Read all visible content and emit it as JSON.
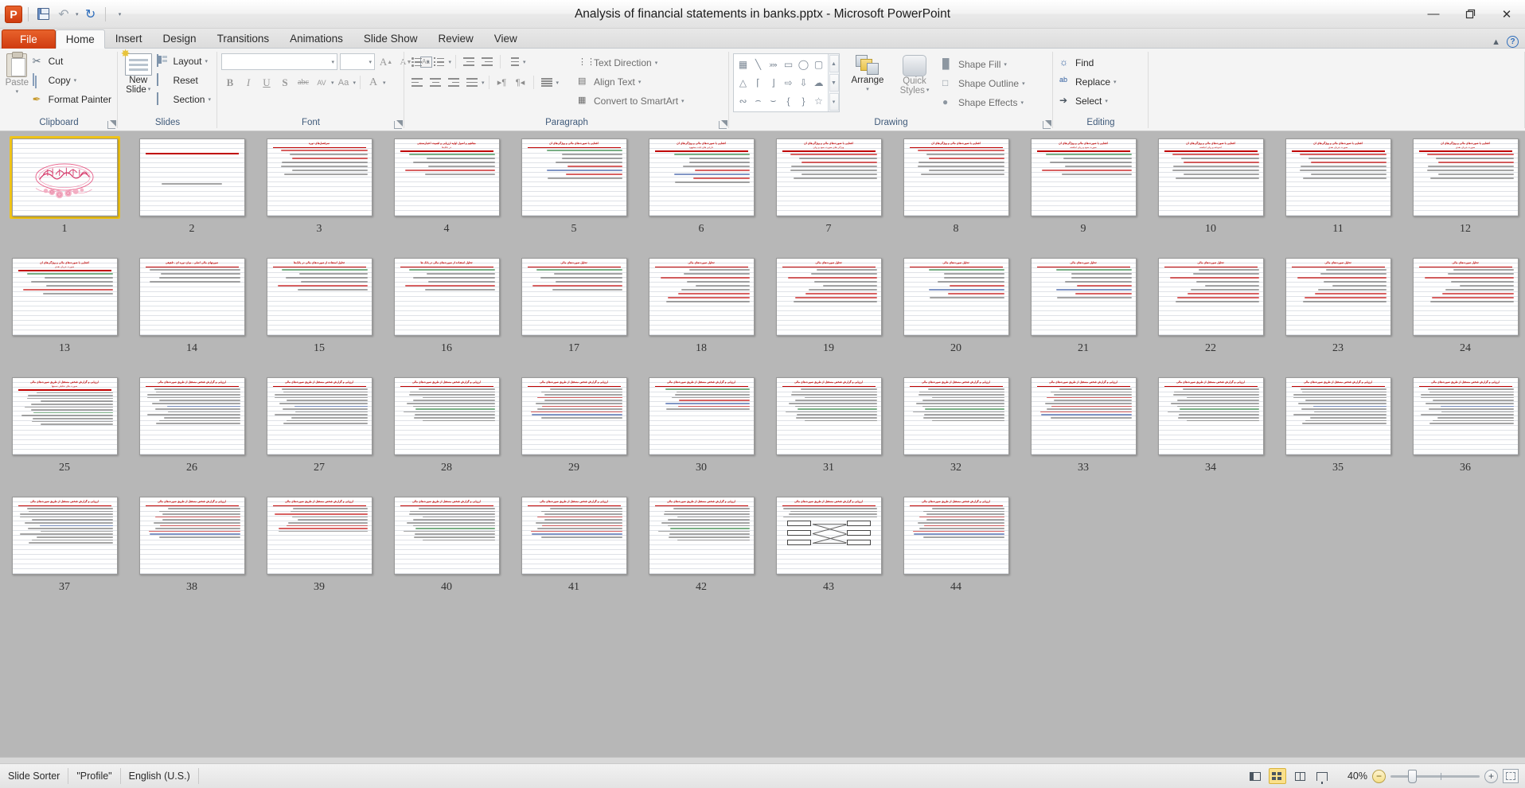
{
  "window": {
    "title": "Analysis of financial statements in banks.pptx  -  Microsoft PowerPoint",
    "app_icon": "powerpoint-icon",
    "minimize": "—",
    "restore": "❐",
    "close": "✕"
  },
  "quick_access": {
    "save": "save-icon",
    "undo": "↺",
    "undo_caret": "▾",
    "redo": "↻",
    "customize": "▾"
  },
  "tabs": [
    {
      "label": "File",
      "active": false,
      "file": true
    },
    {
      "label": "Home",
      "active": true
    },
    {
      "label": "Insert",
      "active": false
    },
    {
      "label": "Design",
      "active": false
    },
    {
      "label": "Transitions",
      "active": false
    },
    {
      "label": "Animations",
      "active": false
    },
    {
      "label": "Slide Show",
      "active": false
    },
    {
      "label": "Review",
      "active": false
    },
    {
      "label": "View",
      "active": false
    }
  ],
  "tab_right": {
    "minimize_ribbon": "▲",
    "help": "?"
  },
  "ribbon": {
    "groups": [
      {
        "label": "Clipboard",
        "launcher": true
      },
      {
        "label": "Slides",
        "launcher": false
      },
      {
        "label": "Font",
        "launcher": true
      },
      {
        "label": "Paragraph",
        "launcher": true
      },
      {
        "label": "Drawing",
        "launcher": true
      },
      {
        "label": "Editing",
        "launcher": false
      }
    ],
    "clipboard": {
      "paste": "Paste",
      "paste_caret": "▾",
      "cut": "Cut",
      "copy": "Copy",
      "copy_caret": "▾",
      "format_painter": "Format Painter"
    },
    "slides": {
      "new_slide_line1": "New",
      "new_slide_line2": "Slide",
      "new_slide_caret": "▾",
      "layout": "Layout",
      "layout_caret": "▾",
      "reset": "Reset",
      "section": "Section",
      "section_caret": "▾"
    },
    "font": {
      "font_name": "",
      "font_size": "",
      "grow": "A",
      "shrink": "A",
      "clear_formatting": "Aa",
      "bold": "B",
      "italic": "I",
      "underline": "U",
      "shadow": "S",
      "strikethrough": "abc",
      "spacing": "AV",
      "change_case": "Aa",
      "font_color": "A"
    },
    "paragraph": {
      "bullets": "bullet-list-icon",
      "numbering": "numbered-list-icon",
      "decrease_indent": "decrease-indent-icon",
      "increase_indent": "increase-indent-icon",
      "line_spacing": "line-spacing-icon",
      "align_left": "align-left-icon",
      "align_center": "align-center-icon",
      "align_right": "align-right-icon",
      "justify": "justify-icon",
      "ltr": "▸¶",
      "rtl": "¶◂",
      "columns": "columns-icon",
      "text_direction": "Text Direction",
      "align_text": "Align Text",
      "convert_to_smartart": "Convert to SmartArt"
    },
    "drawing": {
      "shapes": [
        "text-box",
        "line",
        "arrow",
        "rectangle",
        "oval",
        "rounded-rectangle",
        "triangle",
        "elbow-connector",
        "elbow-arrow-connector",
        "right-arrow",
        "down-arrow",
        "cloud",
        "scribble",
        "curve",
        "arc",
        "left-brace",
        "right-brace",
        "star"
      ],
      "arrange": "Arrange",
      "arrange_caret": "▾",
      "quick_styles_line1": "Quick",
      "quick_styles_line2": "Styles",
      "quick_styles_caret": "▾",
      "shape_fill": "Shape Fill",
      "shape_outline": "Shape Outline",
      "shape_effects": "Shape Effects"
    },
    "editing": {
      "find": "Find",
      "replace": "Replace",
      "select": "Select"
    }
  },
  "status": {
    "view_mode": "Slide Sorter",
    "theme": "\"Profile\"",
    "language": "English (U.S.)",
    "zoom_level": "40%",
    "zoom_out": "−",
    "zoom_in": "+",
    "views": [
      {
        "name": "normal-view",
        "label": "Normal",
        "active": false
      },
      {
        "name": "slide-sorter-view",
        "label": "Slide Sorter",
        "active": true
      },
      {
        "name": "reading-view",
        "label": "Reading View",
        "active": false
      },
      {
        "name": "slide-show-view",
        "label": "Slide Show",
        "active": false
      }
    ],
    "fit_to_window": "fit-slide-to-window-icon"
  },
  "sorter": {
    "selected_slide": 1,
    "total_slides": 44,
    "slides": [
      {
        "n": 1,
        "kind": "bismillah",
        "title": "",
        "sub": "",
        "lines": 0
      },
      {
        "n": 2,
        "kind": "title-only",
        "title": "",
        "sub": "",
        "lines": 1
      },
      {
        "n": 3,
        "kind": "bulleted",
        "title": "سرفصل‌های دوره",
        "sub": "",
        "lines": 7
      },
      {
        "n": 4,
        "kind": "bulleted",
        "title": "مفاهیم و اصول اولیه ارزیابی و اهمیت اعتبارسنجی",
        "sub": "در بانک‌ها",
        "lines": 6
      },
      {
        "n": 5,
        "kind": "bulleted",
        "title": "آشنایی با صورت‌های مالی و ویژگی‌های آن",
        "sub": "",
        "lines": 8
      },
      {
        "n": 6,
        "kind": "bulleted",
        "title": "آشنایی با صورت‌های مالی و ویژگی‌های آن",
        "sub": "دارایی های ثابت مشهود",
        "lines": 8
      },
      {
        "n": 7,
        "kind": "bulleted",
        "title": "آشنایی با صورت‌های مالی و ویژگی‌های آن",
        "sub": "ویژگی های صورت سود و زیان",
        "lines": 7
      },
      {
        "n": 8,
        "kind": "bulleted",
        "title": "آشنایی با صورت‌های مالی و ویژگی‌های آن",
        "sub": "",
        "lines": 7
      },
      {
        "n": 9,
        "kind": "bulleted",
        "title": "آشنایی با صورت‌های مالی و ویژگی‌های آن",
        "sub": "صورت سود و زیان انباشته",
        "lines": 6
      },
      {
        "n": 10,
        "kind": "bulleted",
        "title": "آشنایی با صورت‌های مالی و ویژگی‌های آن",
        "sub": "اندوخته و زیان انباشته",
        "lines": 7
      },
      {
        "n": 11,
        "kind": "bulleted",
        "title": "آشنایی با صورت‌های مالی و ویژگی‌های آن",
        "sub": "صورت جریان نقدی",
        "lines": 7
      },
      {
        "n": 12,
        "kind": "bulleted",
        "title": "آشنایی با صورت‌های مالی و ویژگی‌های آن",
        "sub": "صورت جریان نقدی",
        "lines": 7
      },
      {
        "n": 13,
        "kind": "bulleted",
        "title": "آشنایی با صورت‌های مالی و ویژگی‌های آن",
        "sub": "صورت جریان نقدی",
        "lines": 6
      },
      {
        "n": 14,
        "kind": "bulleted",
        "title": "صورتهای مالی اصلی ، میان دوره ای ، تلفیقی",
        "sub": "",
        "lines": 4
      },
      {
        "n": 15,
        "kind": "bulleted",
        "title": "تحلیل استفاده از صورت‌های مالی در بانک‌ها",
        "sub": "",
        "lines": 6
      },
      {
        "n": 16,
        "kind": "bulleted",
        "title": "تحلیل استفاده از صورت‌های مالی در بانک ها",
        "sub": "",
        "lines": 6
      },
      {
        "n": 17,
        "kind": "bulleted",
        "title": "تحلیل صورت‌های مالی",
        "sub": "",
        "lines": 6
      },
      {
        "n": 18,
        "kind": "bulleted",
        "title": "تحلیل صورت‌های مالی",
        "sub": "",
        "lines": 9
      },
      {
        "n": 19,
        "kind": "bulleted",
        "title": "تحلیل صورت‌های مالی",
        "sub": "",
        "lines": 9
      },
      {
        "n": 20,
        "kind": "bulleted",
        "title": "تحلیل صورت‌های مالی",
        "sub": "",
        "lines": 8
      },
      {
        "n": 21,
        "kind": "bulleted",
        "title": "تحلیل صورت‌های مالی",
        "sub": "",
        "lines": 8
      },
      {
        "n": 22,
        "kind": "bulleted",
        "title": "تحلیل صورت‌های مالی",
        "sub": "",
        "lines": 9
      },
      {
        "n": 23,
        "kind": "bulleted",
        "title": "تحلیل صورت‌های مالی",
        "sub": "",
        "lines": 9
      },
      {
        "n": 24,
        "kind": "bulleted",
        "title": "تحلیل صورت‌های مالی",
        "sub": "",
        "lines": 9
      },
      {
        "n": 25,
        "kind": "dense",
        "title": "ارزیابی و گزارش شخص مستقل از طریق صورت‌های مالی",
        "sub": "صورت های تحلیلی نسبتها",
        "lines": 12
      },
      {
        "n": 26,
        "kind": "dense",
        "title": "ارزیابی و گزارش شخص مستقل از طریق صورت‌های مالی",
        "sub": "",
        "lines": 13
      },
      {
        "n": 27,
        "kind": "dense",
        "title": "ارزیابی و گزارش شخص مستقل از طریق صورت‌های مالی",
        "sub": "",
        "lines": 13
      },
      {
        "n": 28,
        "kind": "dense",
        "title": "ارزیابی و گزارش شخص مستقل از طریق صورت‌های مالی",
        "sub": "",
        "lines": 12
      },
      {
        "n": 29,
        "kind": "dense",
        "title": "ارزیابی و گزارش شخص مستقل از طریق صورت‌های مالی",
        "sub": "",
        "lines": 11
      },
      {
        "n": 30,
        "kind": "dense",
        "title": "ارزیابی و گزارش شخص مستقل از طریق صورت‌های مالی",
        "sub": "",
        "lines": 8
      },
      {
        "n": 31,
        "kind": "dense",
        "title": "ارزیابی و گزارش شخص مستقل از طریق صورت‌های مالی",
        "sub": "",
        "lines": 12
      },
      {
        "n": 32,
        "kind": "dense",
        "title": "ارزیابی و گزارش شخص مستقل از طریق صورت‌های مالی",
        "sub": "",
        "lines": 12
      },
      {
        "n": 33,
        "kind": "dense",
        "title": "ارزیابی و گزارش شخص مستقل از طریق صورت‌های مالی",
        "sub": "",
        "lines": 11
      },
      {
        "n": 34,
        "kind": "dense",
        "title": "ارزیابی و گزارش شخص مستقل از طریق صورت‌های مالی",
        "sub": "",
        "lines": 12
      },
      {
        "n": 35,
        "kind": "dense",
        "title": "ارزیابی و گزارش شخص مستقل از طریق صورت‌های مالی",
        "sub": "",
        "lines": 13
      },
      {
        "n": 36,
        "kind": "dense",
        "title": "ارزیابی و گزارش شخص مستقل از طریق صورت‌های مالی",
        "sub": "",
        "lines": 13
      },
      {
        "n": 37,
        "kind": "dense",
        "title": "ارزیابی و گزارش شخص مستقل از طریق صورت‌های مالی",
        "sub": "",
        "lines": 13
      },
      {
        "n": 38,
        "kind": "dense",
        "title": "ارزیابی و گزارش شخص مستقل از طریق صورت‌های مالی",
        "sub": "",
        "lines": 11
      },
      {
        "n": 39,
        "kind": "dense",
        "title": "ارزیابی و گزارش شخص مستقل از طریق صورت‌های مالی",
        "sub": "",
        "lines": 9
      },
      {
        "n": 40,
        "kind": "dense",
        "title": "ارزیابی و گزارش شخص مستقل از طریق صورت‌های مالی",
        "sub": "",
        "lines": 12
      },
      {
        "n": 41,
        "kind": "dense",
        "title": "ارزیابی و گزارش شخص مستقل از طریق صورت‌های مالی",
        "sub": "",
        "lines": 11
      },
      {
        "n": 42,
        "kind": "dense",
        "title": "ارزیابی و گزارش شخص مستقل از طریق صورت‌های مالی",
        "sub": "",
        "lines": 12
      },
      {
        "n": 43,
        "kind": "diagram",
        "title": "ارزیابی و گزارش شخص مستقل از طریق صورت‌های مالی",
        "sub": "",
        "lines": 4
      },
      {
        "n": 44,
        "kind": "dense",
        "title": "ارزیابی و گزارش شخص مستقل از طریق صورت‌های مالی",
        "sub": "",
        "lines": 11
      }
    ]
  },
  "colors": {
    "accent_orange": "#cf3b10",
    "slide_title_red": "#c00000",
    "selection_yellow": "#f0c419",
    "workspace_gray": "#b7b7b7"
  }
}
